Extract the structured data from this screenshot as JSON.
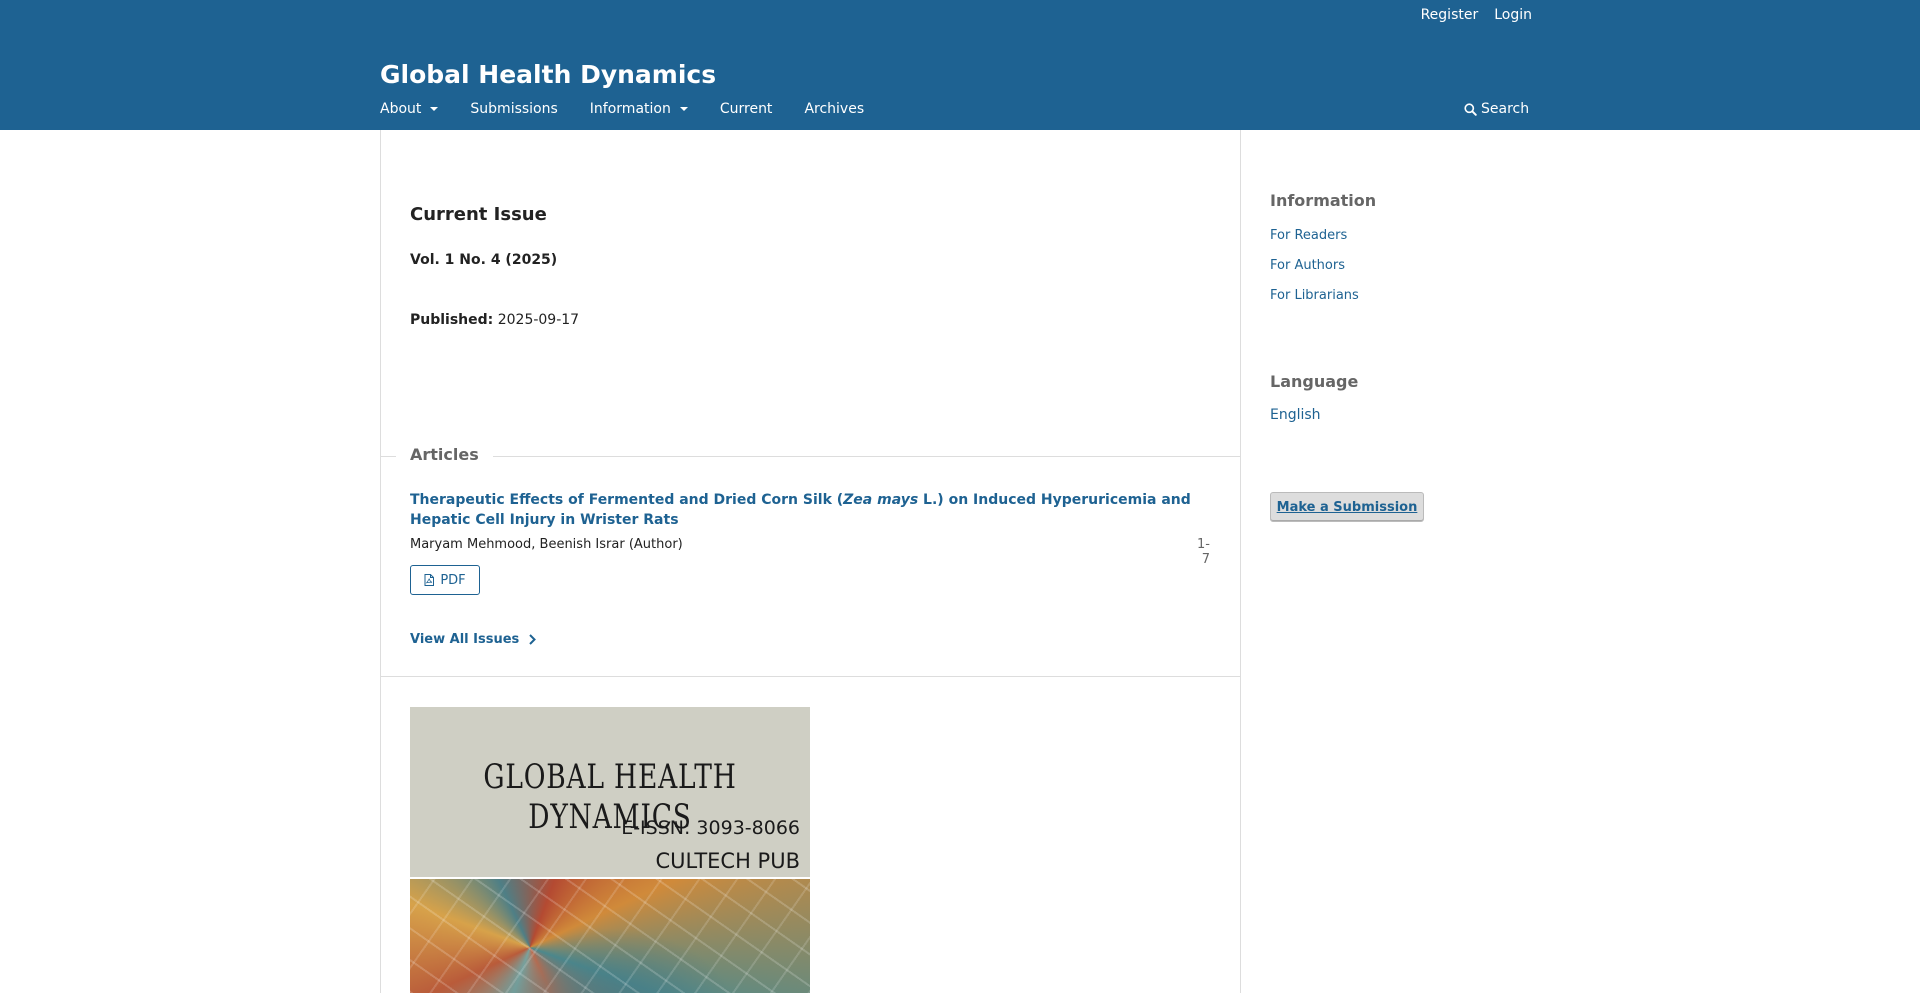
{
  "header": {
    "site_title": "Global Health Dynamics",
    "user_nav": [
      "Register",
      "Login"
    ],
    "primary_nav": [
      {
        "label": "About",
        "dropdown": true
      },
      {
        "label": "Submissions",
        "dropdown": false
      },
      {
        "label": "Information",
        "dropdown": true
      },
      {
        "label": "Current",
        "dropdown": false
      },
      {
        "label": "Archives",
        "dropdown": false
      }
    ],
    "search_label": "Search",
    "background_color": "#1e6292"
  },
  "main": {
    "heading": "Current Issue",
    "issue_identification": "Vol. 1 No. 4 (2025)",
    "published_label": "Published:",
    "published_date": "2025-09-17",
    "section_heading": "Articles",
    "article": {
      "title_before": "Therapeutic Effects of Fermented and Dried Corn Silk (",
      "title_italic": "Zea mays",
      "title_after": " L.) on Induced Hyperuricemia and Hepatic Cell Injury in Wrister Rats",
      "authors": "Maryam Mehmood, Beenish Israr (Author)",
      "pages": "1-7",
      "galley_label": "PDF"
    },
    "view_all_label": "View All Issues",
    "cover": {
      "title": "GLOBAL HEALTH DYNAMICS",
      "issn": "E-ISSN: 3093-8066",
      "publisher": "CULTECH PUB"
    }
  },
  "sidebar": {
    "information_heading": "Information",
    "information_links": [
      "For Readers",
      "For Authors",
      "For Librarians"
    ],
    "language_heading": "Language",
    "language_current": "English",
    "submission_button": "Make a Submission"
  },
  "colors": {
    "link": "#1e6292",
    "muted_text": "#666666",
    "border": "#dddddd"
  }
}
